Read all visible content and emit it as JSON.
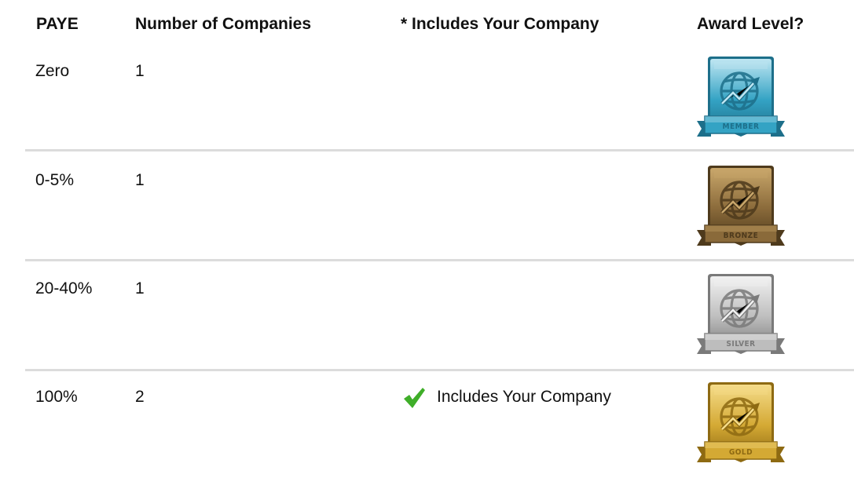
{
  "headers": {
    "paye": "PAYE",
    "count": "Number of Companies",
    "includes": "* Includes Your Company",
    "award": "Award Level?"
  },
  "rows": [
    {
      "paye": "Zero",
      "count": "1",
      "includes": "",
      "badge": {
        "label": "MEMBER",
        "icon": "globe-chart-icon",
        "light": "#bfe6f2",
        "main": "#34a3c4",
        "dark": "#1d6f8a"
      }
    },
    {
      "paye": "0-5%",
      "count": "1",
      "includes": "",
      "badge": {
        "label": "BRONZE",
        "icon": "globe-chart-icon",
        "light": "#c9a76b",
        "main": "#8a6a3a",
        "dark": "#4e3a1c"
      }
    },
    {
      "paye": "20-40%",
      "count": "1",
      "includes": "",
      "badge": {
        "label": "SILVER",
        "icon": "globe-chart-icon",
        "light": "#f2f2f2",
        "main": "#bdbdbd",
        "dark": "#7a7a7a"
      }
    },
    {
      "paye": "100%",
      "count": "2",
      "includes": "Includes Your Company",
      "check_color": "#3fae29",
      "badge": {
        "label": "GOLD",
        "icon": "globe-chart-icon",
        "light": "#f5dc8a",
        "main": "#d4a934",
        "dark": "#8e6a12"
      }
    }
  ]
}
